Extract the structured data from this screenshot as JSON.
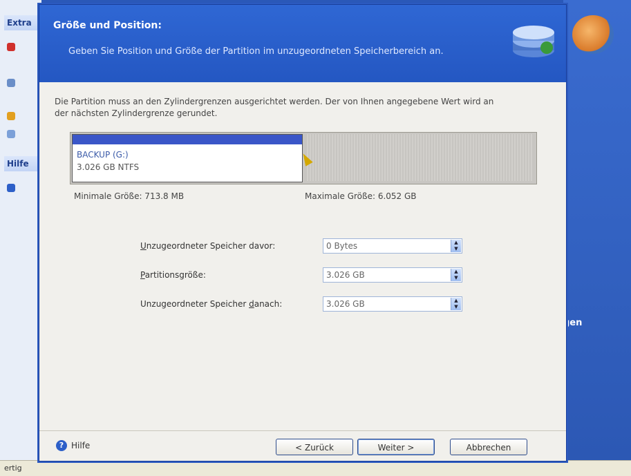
{
  "background": {
    "panel_heading_1": "Extra",
    "panel_heading_2": "Hilfe",
    "status_text": "ertig",
    "right_text": "gen"
  },
  "wizard": {
    "title": "Größe und Position:",
    "subtitle": "Geben Sie Position und Größe der Partition im unzugeordneten Speicherbereich an.",
    "intro": "Die Partition muss an den Zylindergrenzen ausgerichtet werden. Der von Ihnen angegebene Wert wird an der nächsten Zylindergrenze gerundet.",
    "partition": {
      "name": "BACKUP (G:)",
      "size_fs": "3.026 GB  NTFS"
    },
    "min_size": "Minimale Größe: 713.8 MB",
    "max_size": "Maximale Größe: 6.052 GB",
    "fields": [
      {
        "label_access": "U",
        "label_rest": "nzugeordneter Speicher davor:",
        "value": "0 Bytes"
      },
      {
        "label_access": "P",
        "label_rest": "artitionsgröße:",
        "value": "3.026 GB"
      },
      {
        "label_pre": "Unzugeordneter Speicher ",
        "label_access": "d",
        "label_rest": "anach:",
        "value": "3.026 GB"
      }
    ],
    "help_label": "Hilfe",
    "buttons": {
      "back": "< Zurück",
      "next": "Weiter >",
      "cancel": "Abbrechen"
    }
  },
  "colors": {
    "header_blue": "#2f67d4",
    "partition_band": "#3a56c8"
  }
}
